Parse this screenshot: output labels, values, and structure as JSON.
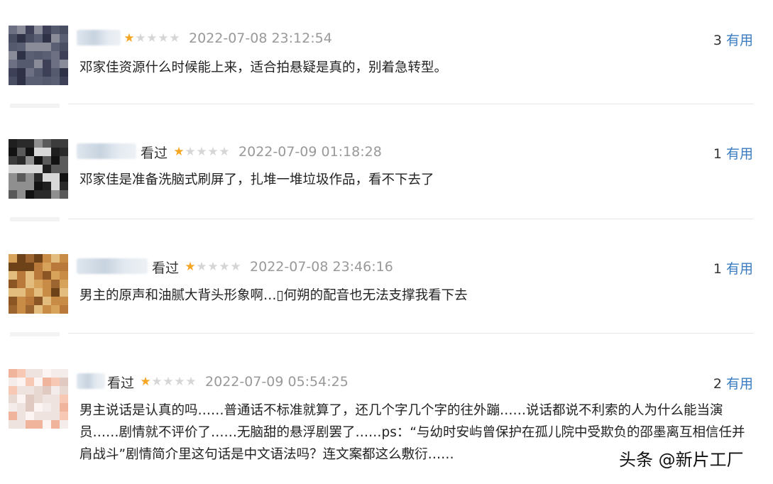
{
  "comments": [
    {
      "seen_label": "",
      "rating": 1,
      "max_rating": 5,
      "time": "2022-07-08 23:12:54",
      "votes": "3",
      "useful_label": "有用",
      "text": "邓家佳资源什么时候能上来，适合拍悬疑是真的，别着急转型。"
    },
    {
      "seen_label": "看过",
      "rating": 1,
      "max_rating": 5,
      "time": "2022-07-09 01:18:28",
      "votes": "1",
      "useful_label": "有用",
      "text": "邓家佳是准备洗脑式刷屏了，扎堆一堆垃圾作品，看不下去了"
    },
    {
      "seen_label": "看过",
      "rating": 1,
      "max_rating": 5,
      "time": "2022-07-08 23:46:16",
      "votes": "1",
      "useful_label": "有用",
      "text": "男主的原声和油腻大背头形象啊…▯何朔的配音也无法支撑我看下去"
    },
    {
      "seen_label": "看过",
      "rating": 1,
      "max_rating": 5,
      "time": "2022-07-09 05:54:25",
      "votes": "2",
      "useful_label": "有用",
      "text": "男主说话是认真的吗……普通话不标准就算了，还几个字几个字的往外蹦……说话都说不利索的人为什么能当演员……剧情就不评价了……无脑甜的悬浮剧罢了……ps：“与幼时安屿曾保护在孤儿院中受欺负的邵墨离互相信任并肩战斗”剧情简介里这句话是中文语法吗？连文案都这么敷衍……"
    }
  ],
  "watermark": "头条 @新片工厂",
  "colors": {
    "star_on": "#f5a623",
    "star_off": "#d6d6d6",
    "useful_link": "#3a7cc2",
    "meta_gray": "#999999"
  }
}
